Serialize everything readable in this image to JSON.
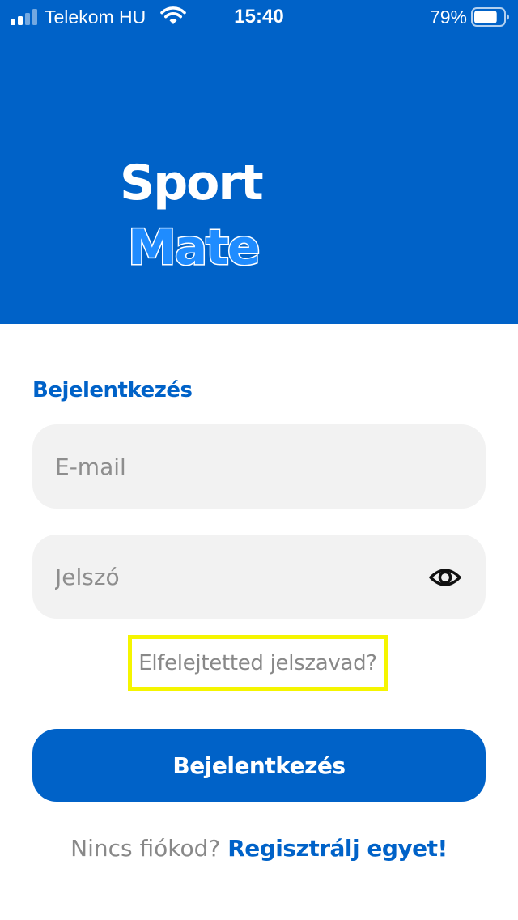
{
  "status_bar": {
    "carrier": "Telekom HU",
    "time": "15:40",
    "battery_percent": "79%",
    "battery_level": 0.79,
    "signal_bars": 2,
    "icons": [
      "signal-icon",
      "wifi-icon",
      "battery-icon"
    ]
  },
  "header": {
    "logo_part1": "Sport",
    "logo_part2": "Mate",
    "background_color": "#0062c8",
    "logo_accent_color": "#1f8cff"
  },
  "login": {
    "title": "Bejelentkezés",
    "email_placeholder": "E-mail",
    "password_placeholder": "Jelszó",
    "show_password_icon": "eye-icon",
    "forgot_password": "Elfelejtetted jelszavad?",
    "submit_label": "Bejelentkezés",
    "register_prefix": "Nincs fiókod?",
    "register_link": "Regisztrálj egyet!"
  },
  "colors": {
    "primary": "#0062c8",
    "field_background": "#f2f2f2",
    "muted_text": "#888888",
    "highlight": "#f5f500"
  }
}
